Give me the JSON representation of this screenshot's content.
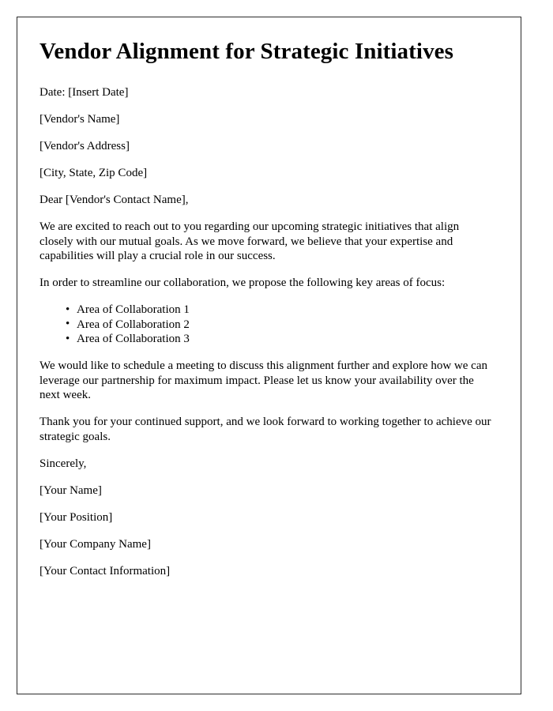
{
  "document": {
    "title": "Vendor Alignment for Strategic Initiatives",
    "date_line": "Date: [Insert Date]",
    "recipient": {
      "name": "[Vendor's Name]",
      "address": "[Vendor's Address]",
      "city_state_zip": "[City, State, Zip Code]"
    },
    "salutation": "Dear [Vendor's Contact Name],",
    "paragraphs": {
      "intro": "We are excited to reach out to you regarding our upcoming strategic initiatives that align closely with our mutual goals. As we move forward, we believe that your expertise and capabilities will play a crucial role in our success.",
      "list_lead_in": "In order to streamline our collaboration, we propose the following key areas of focus:",
      "meeting_request": "We would like to schedule a meeting to discuss this alignment further and explore how we can leverage our partnership for maximum impact. Please let us know your availability over the next week.",
      "closing_thanks": "Thank you for your continued support, and we look forward to working together to achieve our strategic goals."
    },
    "focus_areas": [
      "Area of Collaboration 1",
      "Area of Collaboration 2",
      "Area of Collaboration 3"
    ],
    "sign_off": "Sincerely,",
    "signature_block": [
      "[Your Name]",
      "[Your Position]",
      "[Your Company Name]",
      "[Your Contact Information]"
    ],
    "colors": {
      "page_background": "#ffffff",
      "text": "#000000",
      "border": "#2b2b2b"
    }
  }
}
